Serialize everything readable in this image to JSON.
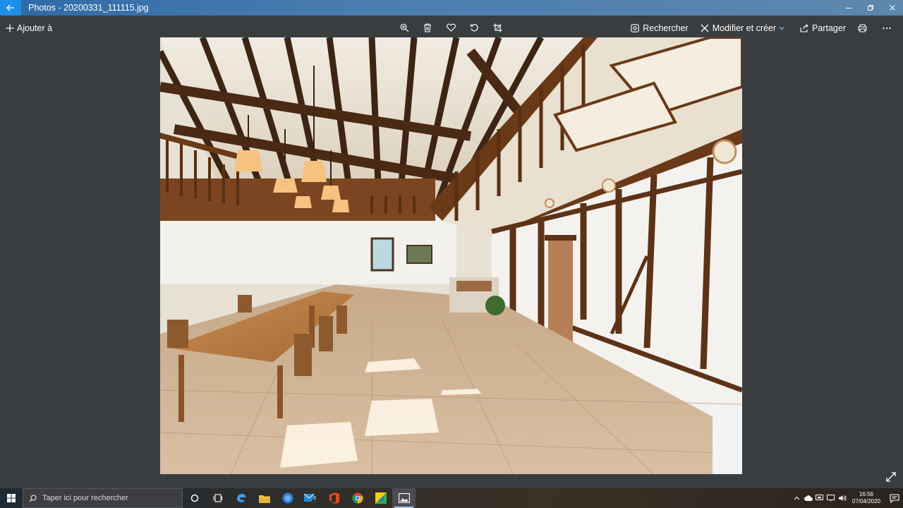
{
  "window": {
    "title": "Photos - 20200331_111115.jpg"
  },
  "toolbar": {
    "add_to_label": "Ajouter à",
    "search_label": "Rechercher",
    "edit_label": "Modifier et créer",
    "share_label": "Partager"
  },
  "taskbar": {
    "search_placeholder": "Taper ici pour rechercher",
    "mail_badge": "3",
    "time": "16:56",
    "date": "07/04/2020"
  },
  "colors": {
    "titlebar": "#3d6fa6",
    "back_button": "#1e8fe8",
    "app_background": "#3a3d40",
    "taskbar": "#2a2b2d"
  }
}
